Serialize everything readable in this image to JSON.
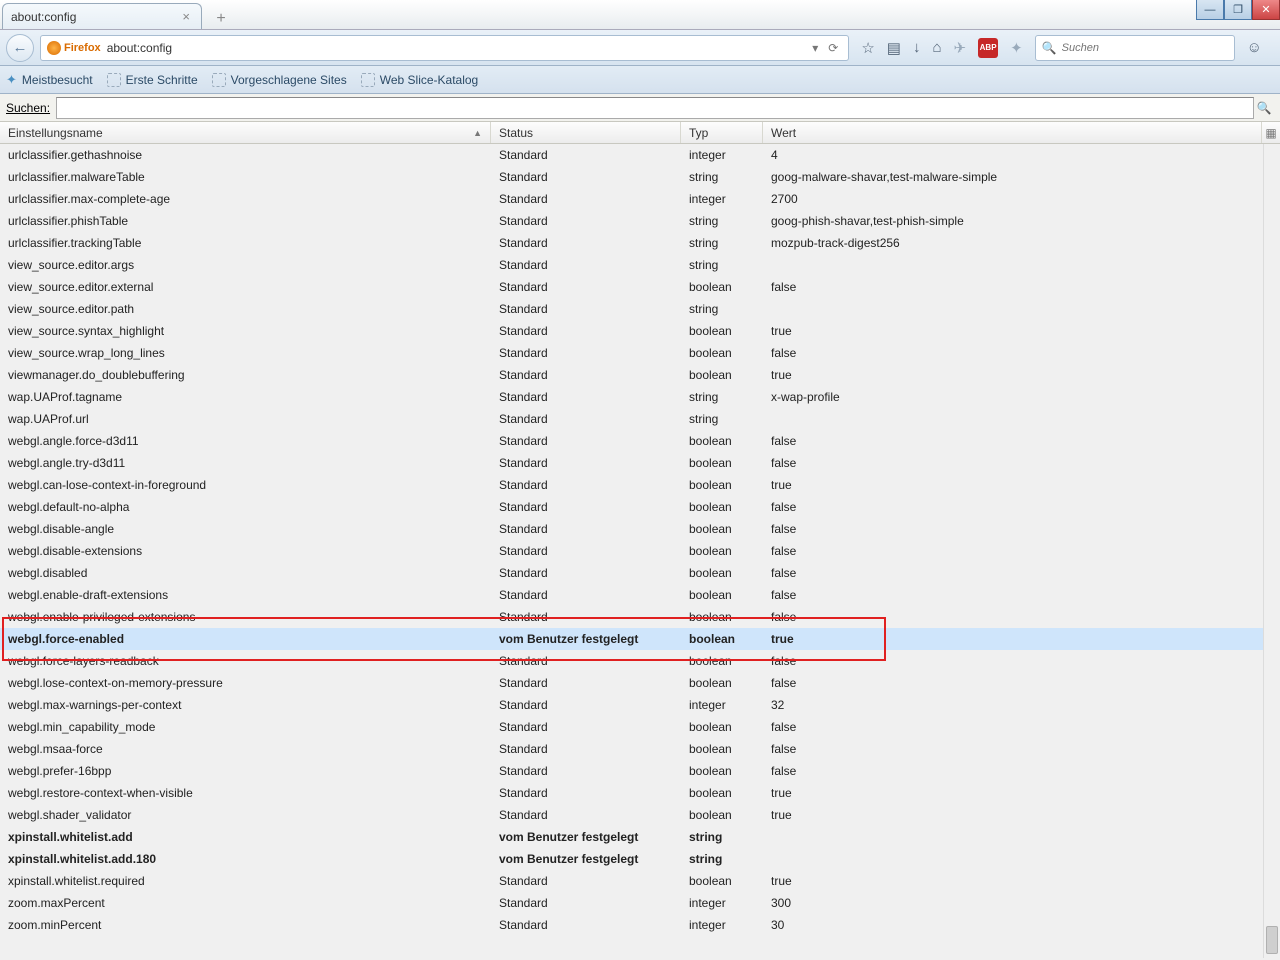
{
  "window": {
    "tab_title": "about:config",
    "url": "about:config",
    "browser_label": "Firefox",
    "search_placeholder": "Suchen"
  },
  "bookmarks": [
    {
      "label": "Meistbesucht",
      "icon": "star"
    },
    {
      "label": "Erste Schritte",
      "icon": "page"
    },
    {
      "label": "Vorgeschlagene Sites",
      "icon": "page"
    },
    {
      "label": "Web Slice-Katalog",
      "icon": "page"
    }
  ],
  "search_label": "Suchen:",
  "columns": {
    "name": "Einstellungsname",
    "status": "Status",
    "type": "Typ",
    "value": "Wert"
  },
  "rows": [
    {
      "name": "urlclassifier.gethashnoise",
      "status": "Standard",
      "type": "integer",
      "value": "4"
    },
    {
      "name": "urlclassifier.malwareTable",
      "status": "Standard",
      "type": "string",
      "value": "goog-malware-shavar,test-malware-simple"
    },
    {
      "name": "urlclassifier.max-complete-age",
      "status": "Standard",
      "type": "integer",
      "value": "2700"
    },
    {
      "name": "urlclassifier.phishTable",
      "status": "Standard",
      "type": "string",
      "value": "goog-phish-shavar,test-phish-simple"
    },
    {
      "name": "urlclassifier.trackingTable",
      "status": "Standard",
      "type": "string",
      "value": "mozpub-track-digest256"
    },
    {
      "name": "view_source.editor.args",
      "status": "Standard",
      "type": "string",
      "value": ""
    },
    {
      "name": "view_source.editor.external",
      "status": "Standard",
      "type": "boolean",
      "value": "false"
    },
    {
      "name": "view_source.editor.path",
      "status": "Standard",
      "type": "string",
      "value": ""
    },
    {
      "name": "view_source.syntax_highlight",
      "status": "Standard",
      "type": "boolean",
      "value": "true"
    },
    {
      "name": "view_source.wrap_long_lines",
      "status": "Standard",
      "type": "boolean",
      "value": "false"
    },
    {
      "name": "viewmanager.do_doublebuffering",
      "status": "Standard",
      "type": "boolean",
      "value": "true"
    },
    {
      "name": "wap.UAProf.tagname",
      "status": "Standard",
      "type": "string",
      "value": "x-wap-profile"
    },
    {
      "name": "wap.UAProf.url",
      "status": "Standard",
      "type": "string",
      "value": ""
    },
    {
      "name": "webgl.angle.force-d3d11",
      "status": "Standard",
      "type": "boolean",
      "value": "false"
    },
    {
      "name": "webgl.angle.try-d3d11",
      "status": "Standard",
      "type": "boolean",
      "value": "false"
    },
    {
      "name": "webgl.can-lose-context-in-foreground",
      "status": "Standard",
      "type": "boolean",
      "value": "true"
    },
    {
      "name": "webgl.default-no-alpha",
      "status": "Standard",
      "type": "boolean",
      "value": "false"
    },
    {
      "name": "webgl.disable-angle",
      "status": "Standard",
      "type": "boolean",
      "value": "false"
    },
    {
      "name": "webgl.disable-extensions",
      "status": "Standard",
      "type": "boolean",
      "value": "false"
    },
    {
      "name": "webgl.disabled",
      "status": "Standard",
      "type": "boolean",
      "value": "false"
    },
    {
      "name": "webgl.enable-draft-extensions",
      "status": "Standard",
      "type": "boolean",
      "value": "false"
    },
    {
      "name": "webgl.enable-privileged-extensions",
      "status": "Standard",
      "type": "boolean",
      "value": "false"
    },
    {
      "name": "webgl.force-enabled",
      "status": "vom Benutzer festgelegt",
      "type": "boolean",
      "value": "true",
      "user": true,
      "selected": true
    },
    {
      "name": "webgl.force-layers-readback",
      "status": "Standard",
      "type": "boolean",
      "value": "false"
    },
    {
      "name": "webgl.lose-context-on-memory-pressure",
      "status": "Standard",
      "type": "boolean",
      "value": "false"
    },
    {
      "name": "webgl.max-warnings-per-context",
      "status": "Standard",
      "type": "integer",
      "value": "32"
    },
    {
      "name": "webgl.min_capability_mode",
      "status": "Standard",
      "type": "boolean",
      "value": "false"
    },
    {
      "name": "webgl.msaa-force",
      "status": "Standard",
      "type": "boolean",
      "value": "false"
    },
    {
      "name": "webgl.prefer-16bpp",
      "status": "Standard",
      "type": "boolean",
      "value": "false"
    },
    {
      "name": "webgl.restore-context-when-visible",
      "status": "Standard",
      "type": "boolean",
      "value": "true"
    },
    {
      "name": "webgl.shader_validator",
      "status": "Standard",
      "type": "boolean",
      "value": "true"
    },
    {
      "name": "xpinstall.whitelist.add",
      "status": "vom Benutzer festgelegt",
      "type": "string",
      "value": "",
      "user": true
    },
    {
      "name": "xpinstall.whitelist.add.180",
      "status": "vom Benutzer festgelegt",
      "type": "string",
      "value": "",
      "user": true
    },
    {
      "name": "xpinstall.whitelist.required",
      "status": "Standard",
      "type": "boolean",
      "value": "true"
    },
    {
      "name": "zoom.maxPercent",
      "status": "Standard",
      "type": "integer",
      "value": "300"
    },
    {
      "name": "zoom.minPercent",
      "status": "Standard",
      "type": "integer",
      "value": "30"
    }
  ],
  "highlight": {
    "row_index": 22,
    "span": 3
  }
}
